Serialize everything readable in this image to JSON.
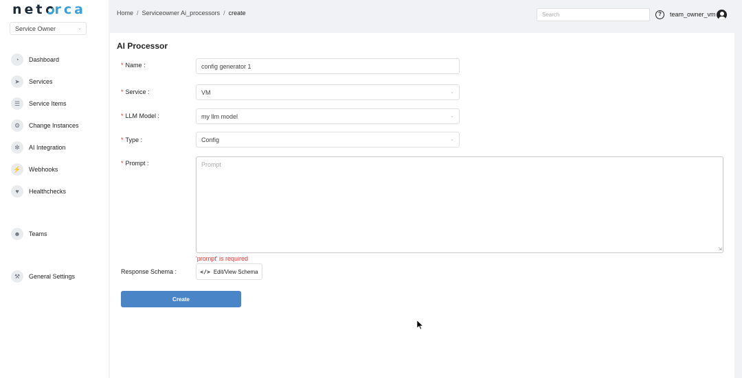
{
  "brand": {
    "logo_pre": "net",
    "logo_post": "rca",
    "accent": "#3aa0d8"
  },
  "role_select": {
    "value": "Service Owner"
  },
  "sidebar": {
    "items": [
      {
        "label": "Dashboard",
        "icon": "dashboard-icon"
      },
      {
        "label": "Services",
        "icon": "rocket-icon"
      },
      {
        "label": "Service Items",
        "icon": "list-icon"
      },
      {
        "label": "Change Instances",
        "icon": "gears-icon"
      },
      {
        "label": "AI Integration",
        "icon": "brain-icon"
      },
      {
        "label": "Webhooks",
        "icon": "plug-icon"
      },
      {
        "label": "Healthchecks",
        "icon": "heartbeat-icon"
      },
      {
        "label": "Teams",
        "icon": "users-icon"
      },
      {
        "label": "General Settings",
        "icon": "wrench-icon"
      }
    ]
  },
  "breadcrumb": {
    "home": "Home",
    "section": "Serviceowner Ai_processors",
    "current": "create"
  },
  "header": {
    "search_placeholder": "Search",
    "username": "team_owner_vm"
  },
  "form": {
    "title": "AI Processor",
    "name": {
      "label": "Name",
      "value": "config generator 1"
    },
    "service": {
      "label": "Service",
      "value": "VM"
    },
    "llm_model": {
      "label": "LLM Model",
      "value": "my llm model"
    },
    "type": {
      "label": "Type",
      "value": "Config"
    },
    "prompt": {
      "label": "Prompt",
      "placeholder": "Prompt",
      "error": "'prompt' is required"
    },
    "response_schema": {
      "label": "Response Schema",
      "button": "Edit/View Schema"
    },
    "submit": "Create"
  }
}
